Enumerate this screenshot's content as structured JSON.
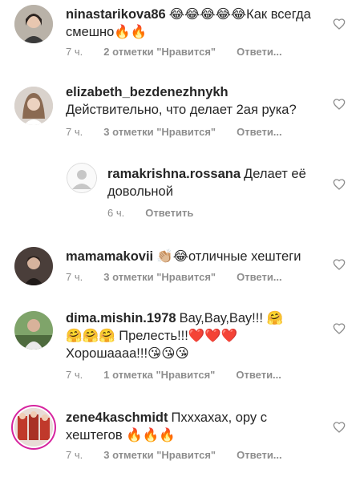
{
  "comments": [
    {
      "username": "ninastarikova86",
      "text": "😂😂😂😂😂Как всегда смешно🔥🔥",
      "time": "7 ч.",
      "likes": "2 отметки \"Нравится\"",
      "reply": "Ответи..."
    },
    {
      "username": "elizabeth_bezdenezhnykh",
      "text": "Действительно, что делает 2ая рука?",
      "time": "7 ч.",
      "likes": "3 отметки \"Нравится\"",
      "reply": "Ответи..."
    },
    {
      "username": "ramakrishna.rossana",
      "text": "Делает её довольной",
      "time": "6 ч.",
      "likes": "",
      "reply": "Ответить"
    },
    {
      "username": "mamamakovii",
      "text": "👏🏼😂отличные хештеги",
      "time": "7 ч.",
      "likes": "3 отметки \"Нравится\"",
      "reply": "Ответи..."
    },
    {
      "username": "dima.mishin.1978",
      "text": "Вау,Вау,Вау!!! 🤗🤗🤗🤗 Прелесть!!!❤️❤️❤️ Хорошаааа!!!😘😘😘",
      "time": "7 ч.",
      "likes": "1 отметка \"Нравится\"",
      "reply": "Ответи..."
    },
    {
      "username": "zene4kaschmidt",
      "text": "Пхххахах, ору с хештегов 🔥🔥🔥",
      "time": "7 ч.",
      "likes": "3 отметки \"Нравится\"",
      "reply": "Ответи..."
    }
  ],
  "colors": {
    "text": "#262626",
    "meta": "#8e8e8e",
    "heart": "#8e8e8e",
    "story_ring": "#d6249f"
  },
  "icons": {
    "like": "heart-outline-icon",
    "default_avatar": "default-avatar-icon"
  }
}
